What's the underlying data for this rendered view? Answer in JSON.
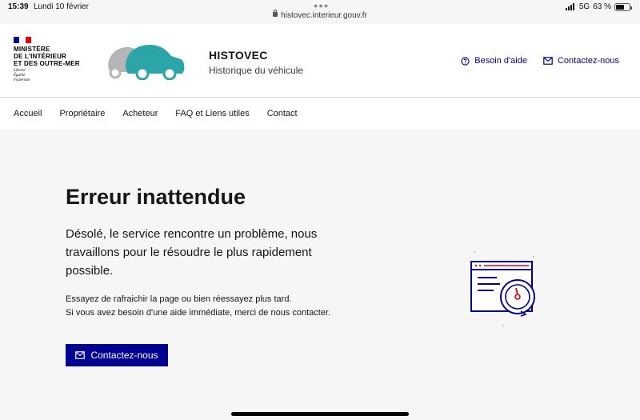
{
  "status_bar": {
    "time": "15:39",
    "date": "Lundi 10 février",
    "url": "histovec.interieur.gouv.fr",
    "network": "5G",
    "battery": "63 %",
    "battery_level": 0.63
  },
  "header": {
    "ministry_lines": [
      "MINISTÈRE",
      "DE L'INTÉRIEUR",
      "ET DES OUTRE-MER"
    ],
    "motto_lines": [
      "Liberté",
      "Égalité",
      "Fraternité"
    ],
    "site_name": "HISTOVEC",
    "site_tagline": "Historique du véhicule",
    "help_label": "Besoin d'aide",
    "contact_label": "Contactez-nous"
  },
  "nav": {
    "items": [
      {
        "label": "Accueil"
      },
      {
        "label": "Propriétaire"
      },
      {
        "label": "Acheteur"
      },
      {
        "label": "FAQ et Liens utiles"
      },
      {
        "label": "Contact"
      }
    ]
  },
  "main": {
    "title": "Erreur inattendue",
    "lead": "Désolé, le service rencontre un problème, nous travaillons pour le résoudre le plus rapidement possible.",
    "line1": "Essayez de rafraichir la page ou bien réessayez plus tard.",
    "line2": "Si vous avez besoin d'une aide immédiate, merci de nous contacter.",
    "cta_label": "Contactez-nous"
  },
  "colors": {
    "primary": "#000091",
    "accent_red": "#e1000f",
    "car_teal": "#2ba5a7",
    "car_grey": "#b5b5b5"
  },
  "icons": [
    "question-circle-icon",
    "mail-icon",
    "error-page-illustration",
    "car-logo"
  ]
}
